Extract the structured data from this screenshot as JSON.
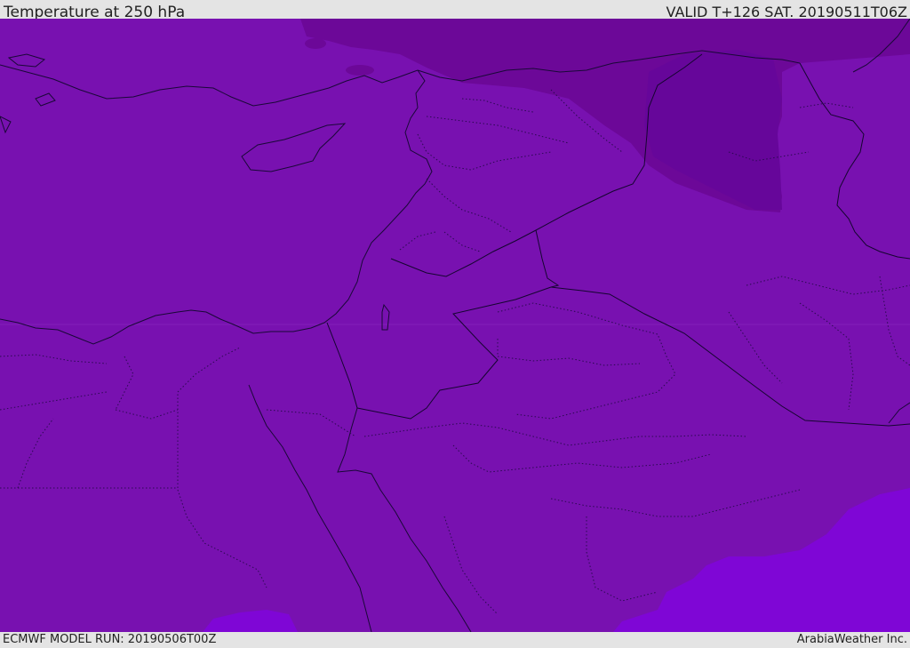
{
  "header": {
    "title": "Temperature at 250 hPa",
    "valid": "VALID T+126 SAT. 20190511T06Z"
  },
  "footer": {
    "model_run": "ECMWF MODEL RUN: 20190506T00Z",
    "credit": "ArabiaWeather Inc."
  },
  "colors": {
    "frame": "#e4e4e4",
    "base_field": "#7811b0",
    "cold_field": "#6c0898",
    "warm_field": "#7f06d6",
    "coastline": "#1a0838"
  },
  "map": {
    "variable": "Temperature",
    "level": "250 hPa",
    "region": "Eastern Mediterranean and Middle East"
  }
}
